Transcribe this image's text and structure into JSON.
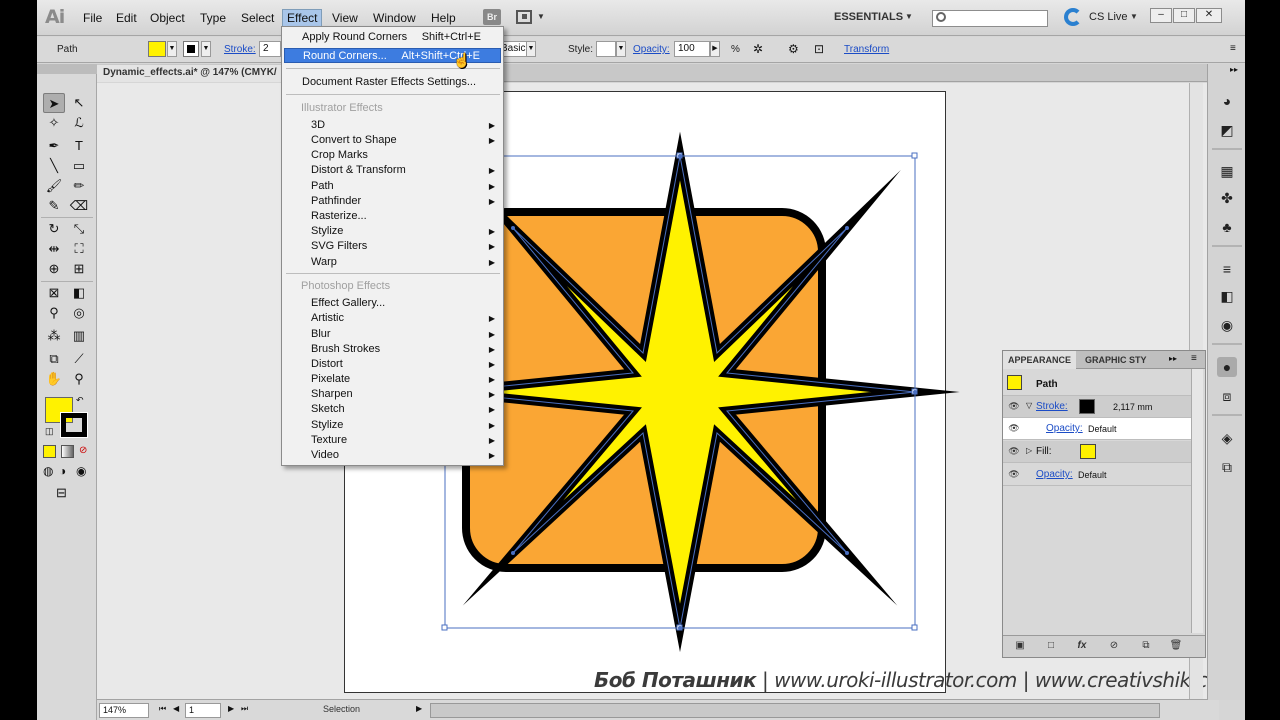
{
  "app": {
    "logo": "Ai",
    "menu": [
      "File",
      "Edit",
      "Object",
      "Type",
      "Select",
      "Effect",
      "View",
      "Window",
      "Help"
    ],
    "bridge_label": "Br",
    "workspace": "ESSENTIALS",
    "cs_live": "CS Live",
    "window_buttons": [
      "–",
      "□",
      "✕"
    ]
  },
  "control_bar": {
    "object_type": "Path",
    "stroke_label": "Stroke:",
    "stroke_value": "2",
    "brush_value": "Basic",
    "style_label": "Style:",
    "opacity_label": "Opacity:",
    "opacity_value": "100",
    "opacity_unit": "%",
    "transform_label": "Transform"
  },
  "document": {
    "tab_title": "Dynamic_effects.ai* @ 147% (CMYK/"
  },
  "status_bar": {
    "zoom": "147%",
    "page": "1",
    "tool": "Selection"
  },
  "effect_menu": {
    "apply_last": "Apply Round Corners",
    "apply_last_shortcut": "Shift+Ctrl+E",
    "last_effect": "Round Corners...",
    "last_effect_shortcut": "Alt+Shift+Ctrl+E",
    "raster_settings": "Document Raster Effects Settings...",
    "illustrator_header": "Illustrator Effects",
    "illustrator_items": [
      "3D",
      "Convert to Shape",
      "Crop Marks",
      "Distort & Transform",
      "Path",
      "Pathfinder",
      "Rasterize...",
      "Stylize",
      "SVG Filters",
      "Warp"
    ],
    "photoshop_header": "Photoshop Effects",
    "photoshop_items": [
      "Effect Gallery...",
      "Artistic",
      "Blur",
      "Brush Strokes",
      "Distort",
      "Pixelate",
      "Sharpen",
      "Sketch",
      "Stylize",
      "Texture",
      "Video"
    ]
  },
  "appearance_panel": {
    "tab_appearance": "APPEARANCE",
    "tab_graphic_styles": "GRAPHIC STY",
    "object": "Path",
    "stroke_label": "Stroke:",
    "stroke_weight": "2,117 mm",
    "stroke_opacity_label": "Opacity:",
    "stroke_opacity_value": "Default",
    "fill_label": "Fill:",
    "opacity_label": "Opacity:",
    "opacity_value": "Default"
  },
  "watermark": {
    "author": "Боб Поташник",
    "sep": "|",
    "site1": "www.uroki-illustrator.com",
    "site2": "www.creativshik.com"
  },
  "colors": {
    "fill_yellow": "#fff200",
    "square_orange": "#faa634",
    "selection_blue": "#4a6fc1",
    "menu_highlight": "#3d7ce0"
  }
}
